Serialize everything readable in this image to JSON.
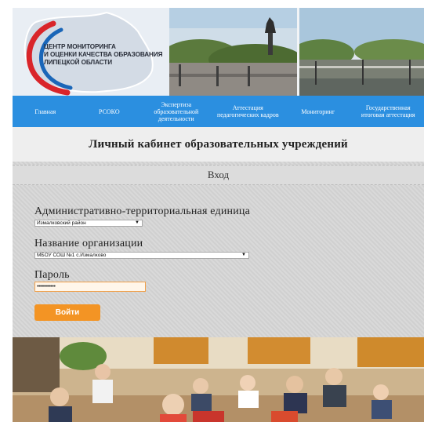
{
  "header": {
    "logo_lines": [
      "ЦЕНТР МОНИТОРИНГА",
      "И ОЦЕНКИ КАЧЕСТВА ОБРАЗОВАНИЯ",
      "ЛИПЕЦКОЙ ОБЛАСТИ"
    ],
    "logo_colors": {
      "red": "#d9252a",
      "blue": "#1a66b8",
      "gray": "#c4ccd6"
    },
    "photos": [
      "city-square-photo",
      "park-boulevard-photo"
    ]
  },
  "nav": {
    "items": [
      {
        "label": "Главная"
      },
      {
        "label": "РСОКО"
      },
      {
        "label": "Экспертиза образовательной деятельности"
      },
      {
        "label": "Аттестация педагогических кадров"
      },
      {
        "label": "Мониторинг"
      },
      {
        "label": "Государственная итоговая аттестация"
      }
    ],
    "background": "#2b8fe0"
  },
  "page": {
    "title": "Личный кабинет образовательных учреждений"
  },
  "login": {
    "heading": "Вход",
    "territory": {
      "label": "Административно-территориальная единица",
      "value": "Измалковский район"
    },
    "organization": {
      "label": "Название организации",
      "value": "МБОУ СОШ №1 с.Измалково"
    },
    "password": {
      "label": "Пароль",
      "value": "••••••••••••"
    },
    "submit_label": "Войти",
    "accent": "#f39424"
  },
  "footer": {
    "photo": "classroom-photo"
  },
  "icons": {
    "dropdown": "chevron-down-icon"
  }
}
